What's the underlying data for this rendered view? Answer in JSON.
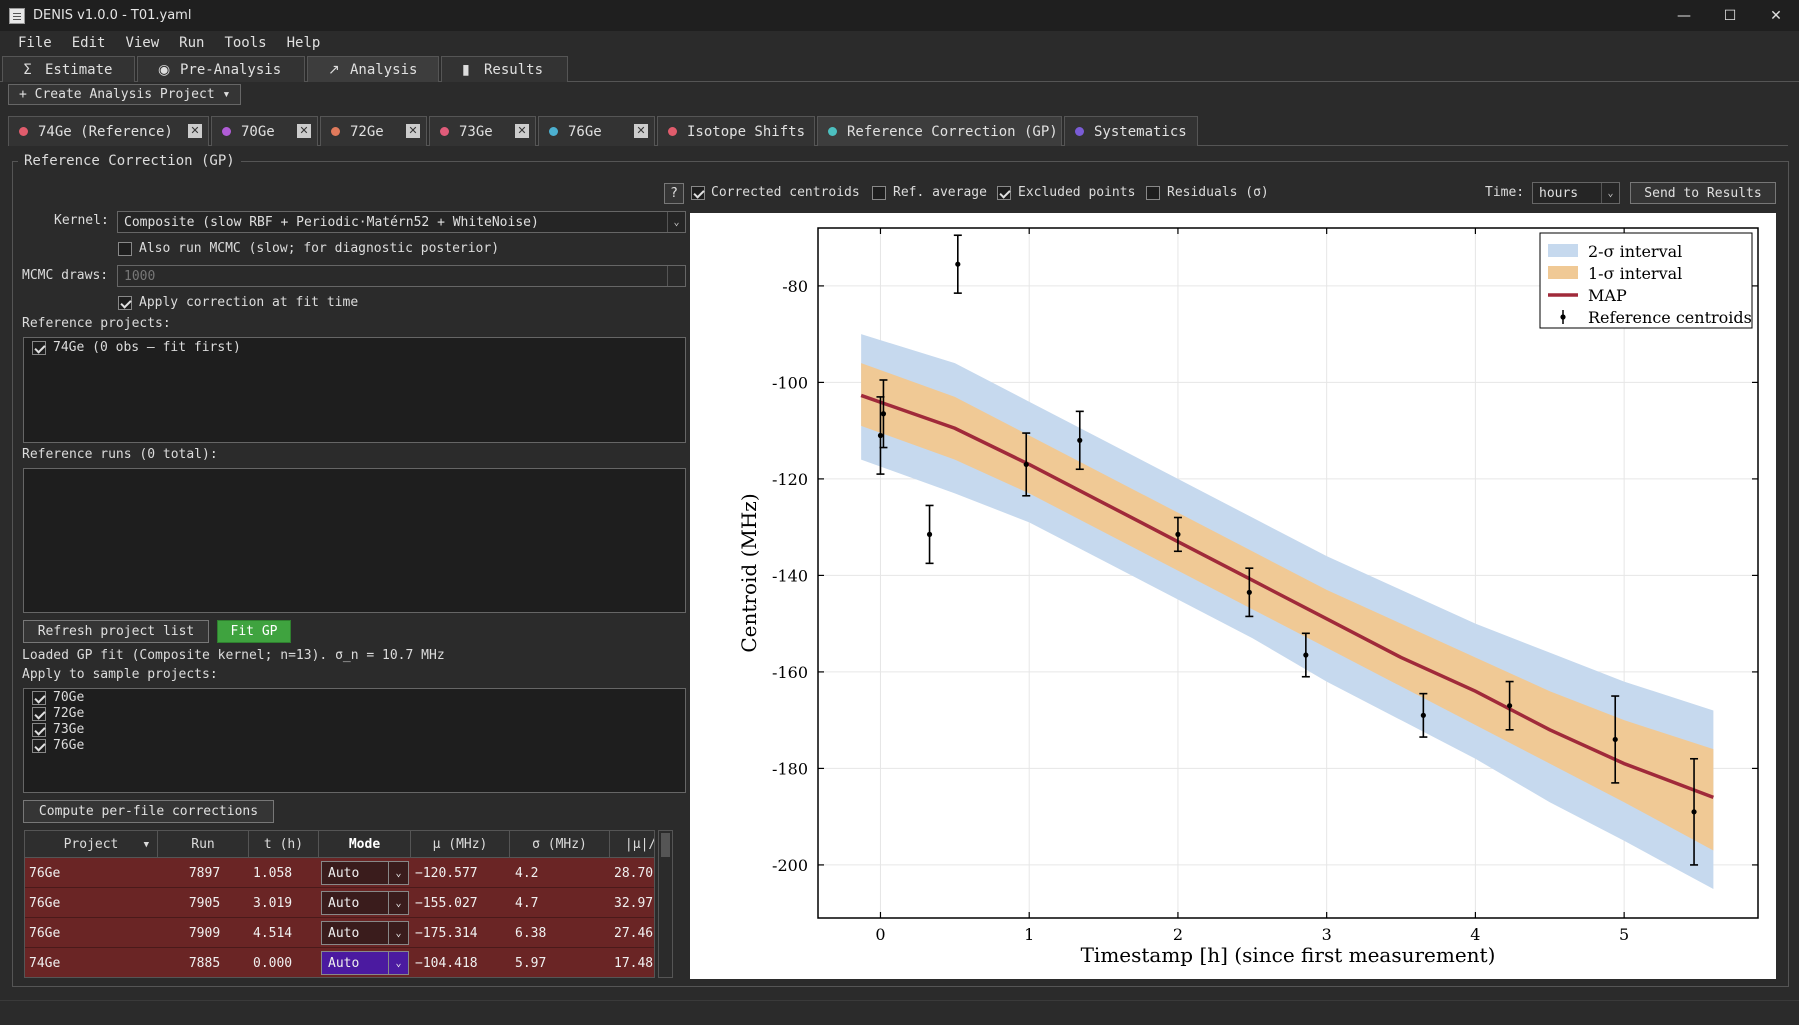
{
  "window": {
    "title": "DENIS v1.0.0 - T01.yaml",
    "minimize": "—",
    "maximize": "☐",
    "close": "✕"
  },
  "menu": [
    "File",
    "Edit",
    "View",
    "Run",
    "Tools",
    "Help"
  ],
  "main_tabs": [
    {
      "label": "Estimate",
      "icon": "Σ"
    },
    {
      "label": "Pre-Analysis",
      "icon": "◉"
    },
    {
      "label": "Analysis",
      "icon": "↗"
    },
    {
      "label": "Results",
      "icon": "▮"
    }
  ],
  "create_button": "+ Create Analysis Project ▾",
  "sub_tabs": [
    {
      "label": "74Ge (Reference)",
      "color": "#e05c6c",
      "close": true
    },
    {
      "label": "70Ge",
      "color": "#b05cd6",
      "close": true
    },
    {
      "label": "72Ge",
      "color": "#e07a5c",
      "close": true
    },
    {
      "label": "73Ge",
      "color": "#e05c7a",
      "close": true
    },
    {
      "label": "76Ge",
      "color": "#4cb0d0",
      "close": true
    },
    {
      "label": "Isotope Shifts",
      "color": "#e05c6c",
      "close": false
    },
    {
      "label": "Reference Correction (GP)",
      "color": "#4cc0c0",
      "close": false
    },
    {
      "label": "Systematics",
      "color": "#7a5cd6",
      "close": false
    }
  ],
  "group_title": "Reference Correction (GP)",
  "toolbar": {
    "help": "?",
    "corrected_centroids": "Corrected centroids",
    "ref_average": "Ref. average",
    "excluded_points": "Excluded points",
    "residuals": "Residuals (σ)",
    "time_label": "Time:",
    "time_value": "hours",
    "send": "Send to Results"
  },
  "kernel_label": "Kernel:",
  "kernel_value": "Composite (slow RBF + Periodic·Matérn52 + WhiteNoise)",
  "mcmc_check": "Also run MCMC (slow; for diagnostic posterior)",
  "mcmc_draws_label": "MCMC draws:",
  "mcmc_draws_value": "1000",
  "apply_check": "Apply correction at fit time",
  "ref_projects_label": "Reference projects:",
  "ref_projects": [
    "74Ge  (0 obs — fit first)"
  ],
  "ref_runs_label": "Reference runs (0 total):",
  "refresh_btn": "Refresh project list",
  "fit_btn": "Fit GP",
  "fit_status": "Loaded GP fit (Composite kernel; n=13). σ_n = 10.7 MHz",
  "apply_samples_label": "Apply to sample projects:",
  "sample_projects": [
    "70Ge",
    "72Ge",
    "73Ge",
    "76Ge"
  ],
  "compute_btn": "Compute per-file corrections",
  "table": {
    "headers": [
      "Project",
      "Run",
      "t (h)",
      "Mode",
      "μ (MHz)",
      "σ (MHz)",
      "|μ|/σ"
    ],
    "rows": [
      [
        "76Ge",
        "7897",
        "1.058",
        "Auto",
        "−120.577",
        "4.2",
        "28.70"
      ],
      [
        "76Ge",
        "7905",
        "3.019",
        "Auto",
        "−155.027",
        "4.7",
        "32.97"
      ],
      [
        "76Ge",
        "7909",
        "4.514",
        "Auto",
        "−175.314",
        "6.38",
        "27.46"
      ],
      [
        "74Ge",
        "7885",
        "0.000",
        "Auto",
        "−104.418",
        "5.97",
        "17.48"
      ]
    ]
  },
  "chart_data": {
    "type": "line",
    "xlabel": "Timestamp [h] (since first measurement)",
    "ylabel": "Centroid (MHz)",
    "xlim": [
      -0.42,
      5.9
    ],
    "ylim": [
      -211,
      -68
    ],
    "xticks": [
      0,
      1,
      2,
      3,
      4,
      5
    ],
    "yticks": [
      -80,
      -100,
      -120,
      -140,
      -160,
      -180,
      -200
    ],
    "grid": true,
    "legend": {
      "placement": "top-right",
      "entries": [
        "2-σ interval",
        "1-σ interval",
        "MAP",
        "Reference centroids"
      ]
    },
    "colors": {
      "band2": "#c6d9ee",
      "band1": "#f0c995",
      "map": "#a02a3a",
      "points": "#000000"
    },
    "map": {
      "x": [
        -0.13,
        0.5,
        1,
        1.5,
        2,
        2.5,
        3,
        3.5,
        4,
        4.5,
        5,
        5.6
      ],
      "y": [
        -102.7,
        -109.5,
        -117,
        -125,
        -133,
        -141,
        -149,
        -157,
        -164,
        -172,
        -179,
        -186
      ]
    },
    "band1": {
      "x": [
        -0.13,
        0.5,
        1,
        1.5,
        2,
        2.5,
        3,
        3.5,
        4,
        4.5,
        5,
        5.6
      ],
      "lower": [
        -109,
        -116,
        -123,
        -131,
        -139,
        -147,
        -155,
        -163,
        -171,
        -179,
        -187,
        -197
      ],
      "upper": [
        -96,
        -103,
        -111,
        -119,
        -127,
        -135,
        -143,
        -150,
        -157,
        -164,
        -170,
        -176
      ]
    },
    "band2": {
      "x": [
        -0.13,
        0.5,
        1,
        1.5,
        2,
        2.5,
        3,
        3.5,
        4,
        4.5,
        5,
        5.6
      ],
      "lower": [
        -116,
        -123,
        -129,
        -137,
        -145,
        -153,
        -162,
        -170,
        -178,
        -187,
        -195,
        -205
      ],
      "upper": [
        -90,
        -96,
        -104,
        -112,
        -120,
        -128,
        -136,
        -143,
        -150,
        -156,
        -162,
        -168
      ]
    },
    "points": [
      {
        "x": 0.0,
        "y": -111,
        "err": 8
      },
      {
        "x": 0.02,
        "y": -106.5,
        "err": 7
      },
      {
        "x": 0.33,
        "y": -131.5,
        "err": 6
      },
      {
        "x": 0.52,
        "y": -75.5,
        "err": 6
      },
      {
        "x": 0.98,
        "y": -117,
        "err": 6.5
      },
      {
        "x": 1.34,
        "y": -112,
        "err": 6
      },
      {
        "x": 2.0,
        "y": -131.5,
        "err": 3.5
      },
      {
        "x": 2.48,
        "y": -143.5,
        "err": 5
      },
      {
        "x": 2.86,
        "y": -156.5,
        "err": 4.5
      },
      {
        "x": 3.65,
        "y": -169,
        "err": 4.5
      },
      {
        "x": 4.23,
        "y": -167,
        "err": 5
      },
      {
        "x": 4.94,
        "y": -174,
        "err": 9
      },
      {
        "x": 5.47,
        "y": -189,
        "err": 11
      }
    ]
  }
}
